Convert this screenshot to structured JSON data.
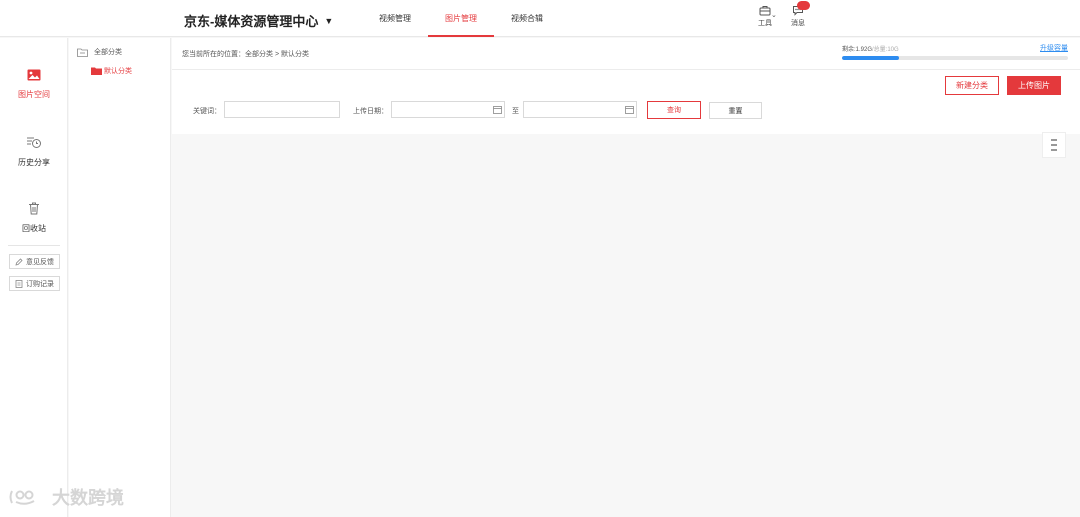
{
  "header": {
    "brand": "京东-媒体资源管理中心",
    "brand_caret": "▼",
    "tabs": [
      {
        "label": "视频管理"
      },
      {
        "label": "图片管理"
      },
      {
        "label": "视频合辑"
      }
    ],
    "active_tab": "图片管理",
    "tools_label": "工具",
    "tools_caret": "⌄",
    "messages_label": "消息",
    "accent_color": "#e4393c"
  },
  "sidebar": {
    "items": [
      {
        "label": "图片空间",
        "icon": "image-icon"
      },
      {
        "label": "历史分享",
        "icon": "history-icon"
      },
      {
        "label": "回收站",
        "icon": "trash-icon"
      }
    ],
    "feedback_label": "意见反馈",
    "orders_label": "订购记录"
  },
  "tree": {
    "root_label": "全部分类",
    "child_label": "默认分类"
  },
  "breadcrumb": {
    "text": "您当前所在的位置：全部分类 > 默认分类"
  },
  "quota": {
    "remaining": "剩余:1.92G",
    "total": "/总量:10G",
    "used_fraction": 0.25,
    "upgrade_label": "升级容量"
  },
  "actions": {
    "new_category": "新建分类",
    "upload": "上传图片"
  },
  "filters": {
    "keyword_label": "关键词：",
    "keyword_value": "",
    "date_label": "上传日期：",
    "date_from": "",
    "date_to_label": "至",
    "date_to": "",
    "query_label": "查询",
    "reset_label": "重置"
  },
  "watermark": "大数跨境"
}
